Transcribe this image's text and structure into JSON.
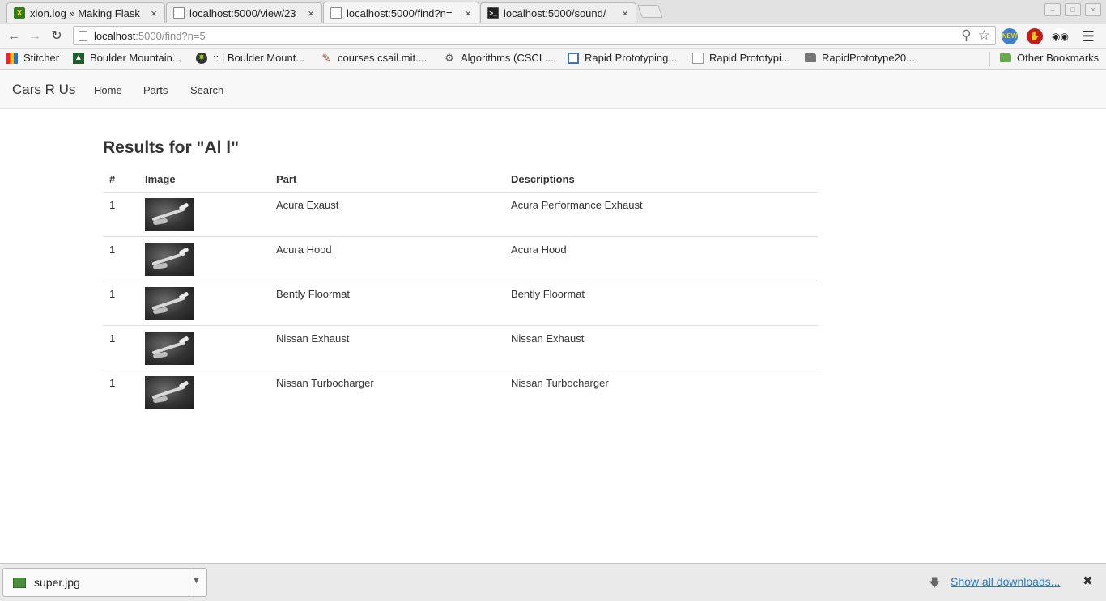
{
  "browser": {
    "tabs": [
      {
        "title": "xion.log » Making Flask",
        "icon": "xion-icon"
      },
      {
        "title": "localhost:5000/view/23",
        "icon": "page-icon"
      },
      {
        "title": "localhost:5000/find?n=",
        "icon": "page-icon"
      },
      {
        "title": "localhost:5000/sound/",
        "icon": "terminal-icon"
      }
    ],
    "address": {
      "host": "localhost",
      "path": ":5000/find?n=5"
    },
    "extensions": {
      "new_badge": "NEW",
      "new_count": "0"
    },
    "bookmarks": [
      {
        "label": "Stitcher",
        "icon": "stitcher-icon"
      },
      {
        "label": "Boulder Mountain...",
        "icon": "mountain-icon"
      },
      {
        "label": ":: | Boulder Mount...",
        "icon": "gear-logo-icon"
      },
      {
        "label": "courses.csail.mit....",
        "icon": "pencil-icon"
      },
      {
        "label": "Algorithms (CSCI ...",
        "icon": "cog-icon"
      },
      {
        "label": "Rapid Prototyping...",
        "icon": "window-icon"
      },
      {
        "label": "Rapid Prototypi...",
        "icon": "document-icon"
      },
      {
        "label": "RapidPrototype20...",
        "icon": "folder-icon"
      }
    ],
    "other_bookmarks": "Other Bookmarks"
  },
  "navbar": {
    "brand": "Cars R Us",
    "links": [
      "Home",
      "Parts",
      "Search"
    ]
  },
  "main": {
    "heading": "Results for \"Al l\"",
    "columns": [
      "#",
      "Image",
      "Part",
      "Descriptions"
    ],
    "rows": [
      {
        "num": "1",
        "part": "Acura Exaust",
        "description": "Acura Performance Exhaust"
      },
      {
        "num": "1",
        "part": "Acura Hood",
        "description": "Acura Hood"
      },
      {
        "num": "1",
        "part": "Bently Floormat",
        "description": "Bently Floormat"
      },
      {
        "num": "1",
        "part": "Nissan Exhaust",
        "description": "Nissan Exhaust"
      },
      {
        "num": "1",
        "part": "Nissan Turbocharger",
        "description": "Nissan Turbocharger"
      }
    ]
  },
  "downloads": {
    "file": "super.jpg",
    "show_all": "Show all downloads..."
  },
  "colors": {
    "link": "#2a7bc0",
    "navbar_bg": "#f8f8f8",
    "text": "#333333"
  }
}
